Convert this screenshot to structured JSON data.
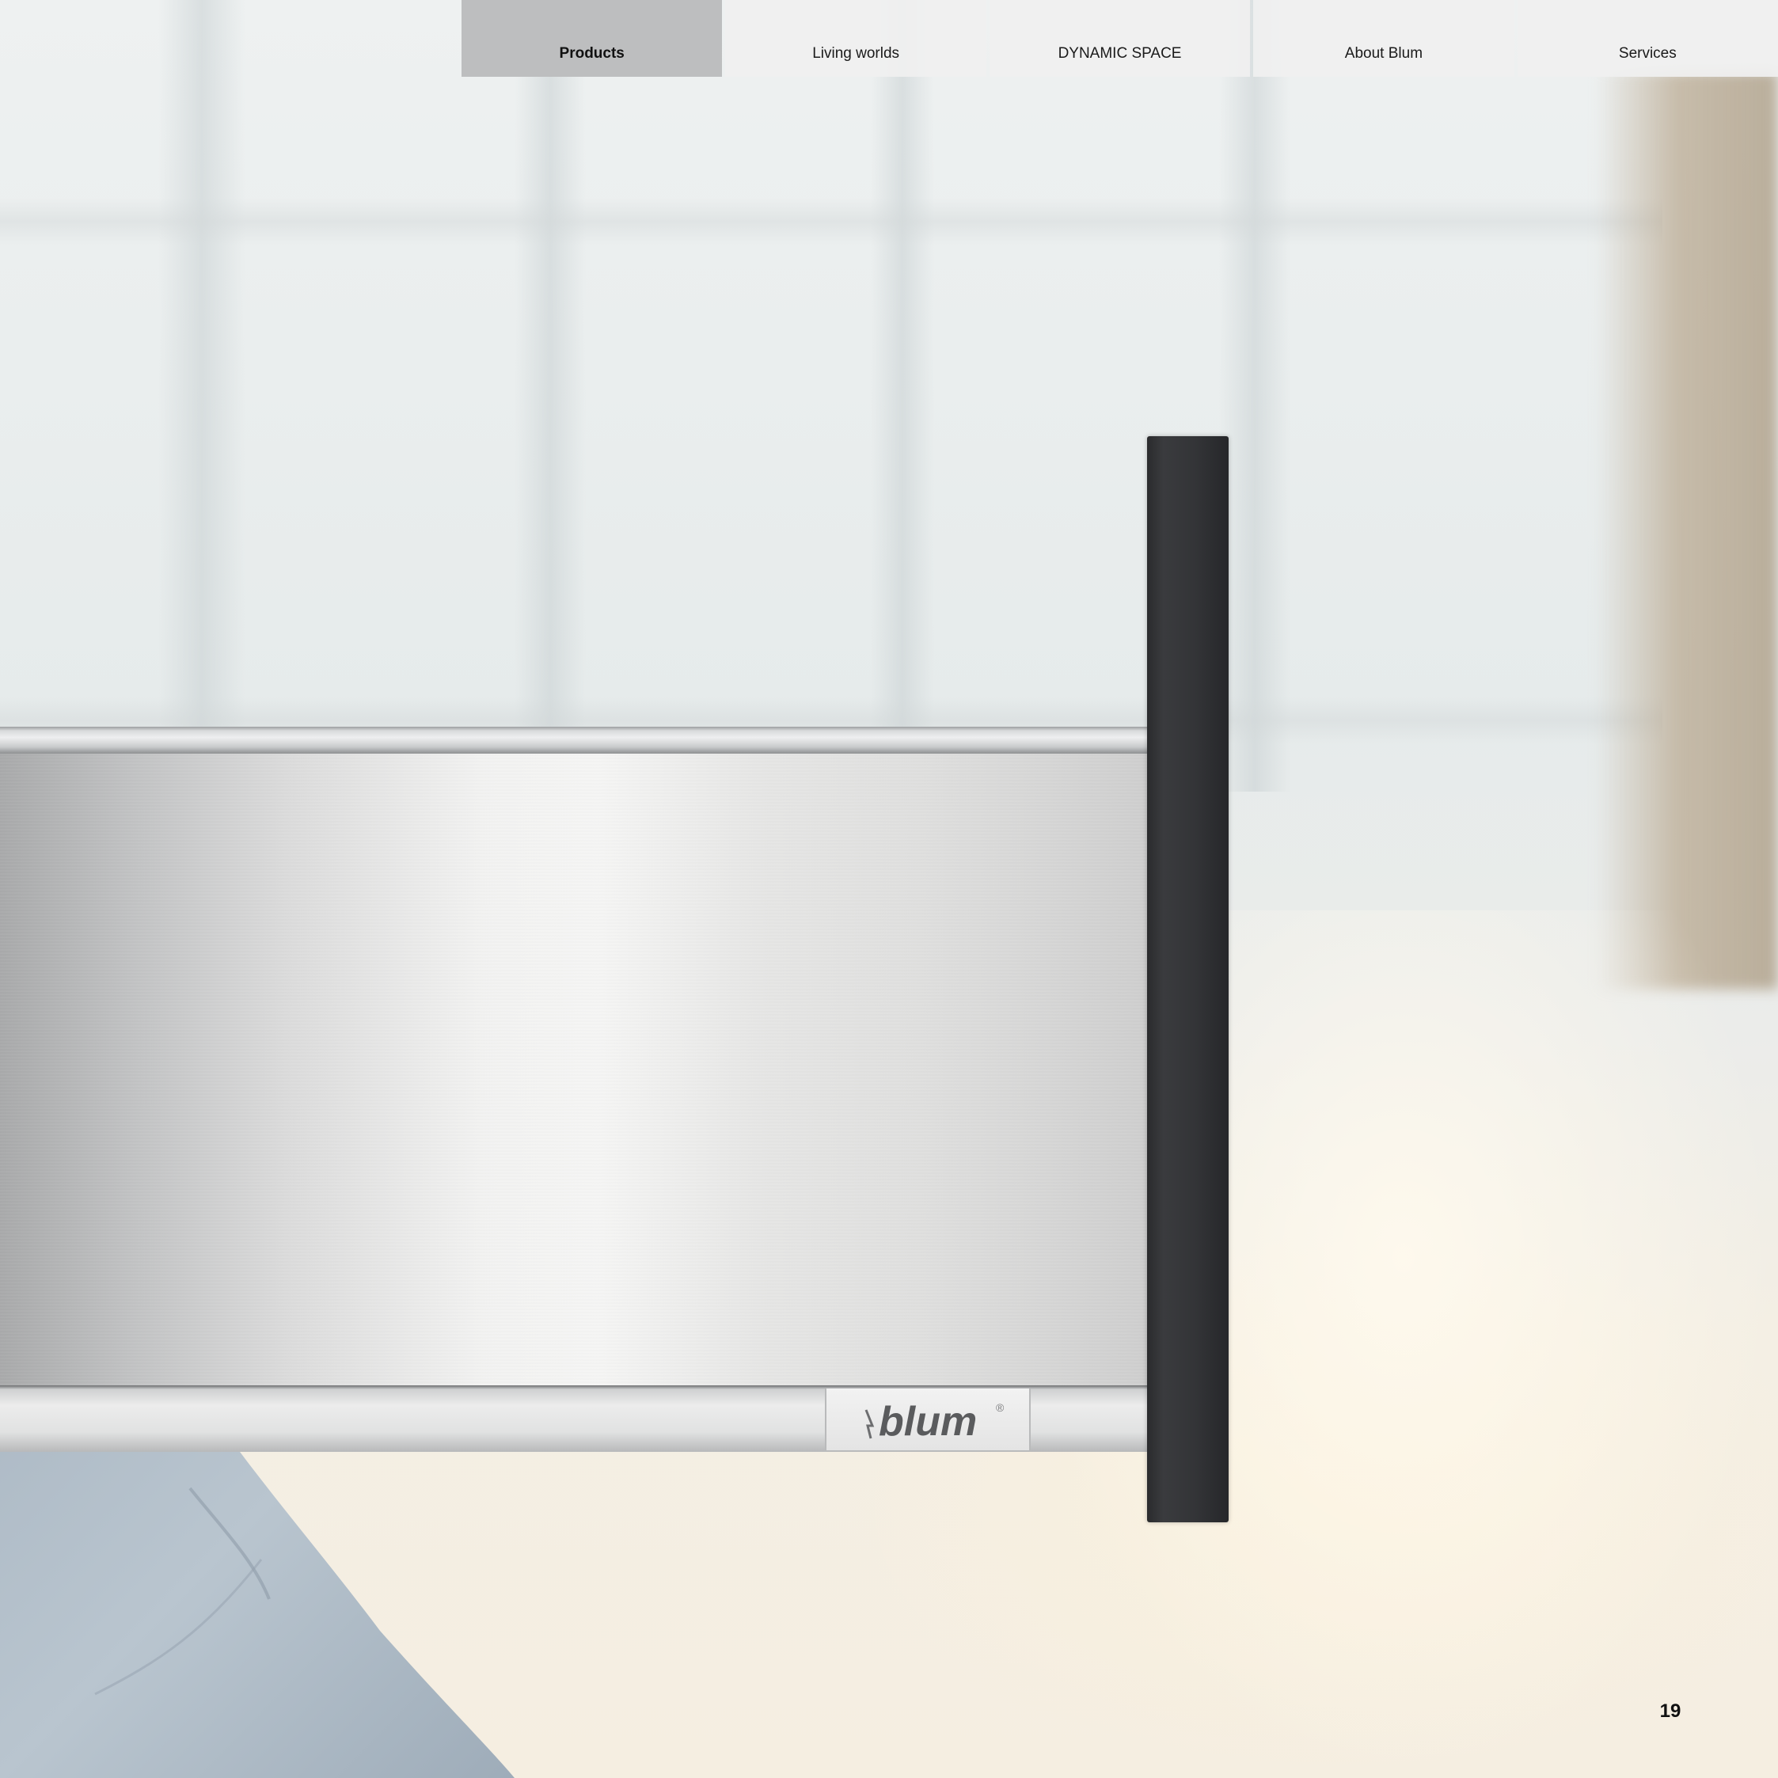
{
  "navigation": {
    "tabs": [
      {
        "label": "Products",
        "active": true
      },
      {
        "label": "Living worlds",
        "active": false
      },
      {
        "label": "DYNAMIC SPACE",
        "active": false
      },
      {
        "label": "About Blum",
        "active": false
      },
      {
        "label": "Services",
        "active": false
      }
    ]
  },
  "logo": {
    "text": "blum",
    "mark": "®"
  },
  "page": {
    "number": "19"
  },
  "colors": {
    "active_tab": "#bdbebf",
    "inactive_tab": "#f0f0f0",
    "handle": "#333437"
  }
}
